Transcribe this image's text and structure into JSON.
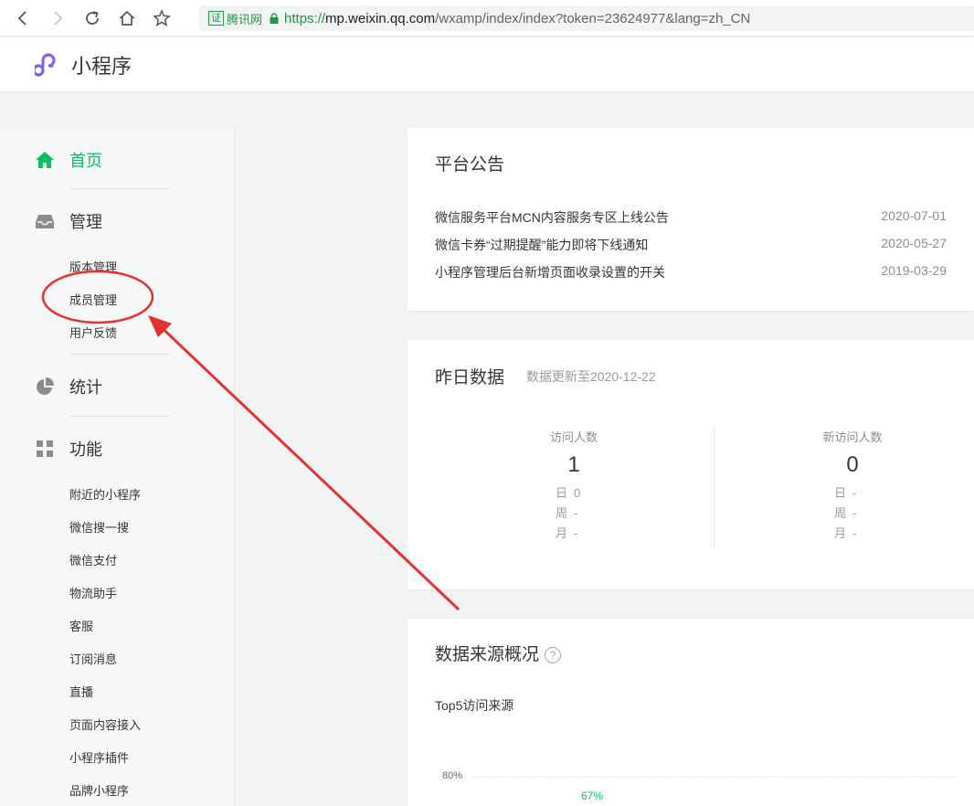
{
  "browser": {
    "cert_label": "证",
    "cert_org": "腾讯网",
    "url_scheme": "https://",
    "url_host": "mp.weixin.qq.com",
    "url_path": "/wxamp/index/index?token=23624977&lang=zh_CN"
  },
  "header": {
    "title": "小程序"
  },
  "sidebar": {
    "home": "首页",
    "manage": "管理",
    "manage_items": [
      "版本管理",
      "成员管理",
      "用户反馈"
    ],
    "stats": "统计",
    "features": "功能",
    "feature_items": [
      "附近的小程序",
      "微信搜一搜",
      "微信支付",
      "物流助手",
      "客服",
      "订阅消息",
      "直播",
      "页面内容接入",
      "小程序插件",
      "品牌小程序"
    ]
  },
  "notices": {
    "title": "平台公告",
    "items": [
      {
        "text": "微信服务平台MCN内容服务专区上线公告",
        "date": "2020-07-01"
      },
      {
        "text": "微信卡券“过期提醒”能力即将下线通知",
        "date": "2020-05-27"
      },
      {
        "text": "小程序管理后台新增页面收录设置的开关",
        "date": "2019-03-29"
      }
    ]
  },
  "yesterday": {
    "title": "昨日数据",
    "update_note": "数据更新至2020-12-22",
    "visitors": {
      "label": "访问人数",
      "value": "1",
      "day_label": "日",
      "day_value": "0",
      "week_label": "周",
      "week_value": "-",
      "month_label": "月",
      "month_value": "-"
    },
    "new_visitors": {
      "label": "新访问人数",
      "value": "0",
      "day_label": "日",
      "day_value": "-",
      "week_label": "周",
      "week_value": "-",
      "month_label": "月",
      "month_value": "-"
    }
  },
  "sources": {
    "title": "数据来源概况",
    "help": "?",
    "subtitle": "Top5访问来源",
    "tick": "80%",
    "first_value": "67%"
  },
  "colors": {
    "accent": "#07c160",
    "annotation": "#e5322d"
  }
}
